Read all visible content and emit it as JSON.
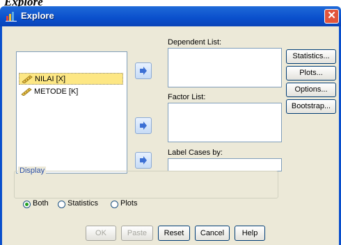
{
  "caption": "Explore",
  "window": {
    "title": "Explore",
    "close_symbol": "✕"
  },
  "variables": [
    {
      "label": "NILAI [X]",
      "icon": "scale-ruler-icon",
      "selected": true
    },
    {
      "label": "METODE [K]",
      "icon": "scale-ruler-icon",
      "selected": false
    }
  ],
  "labels": {
    "dependent_list": "Dependent List:",
    "factor_list": "Factor List:",
    "label_cases_by": "Label Cases by:"
  },
  "side_buttons": {
    "statistics": "Statistics...",
    "plots": "Plots...",
    "options": "Options...",
    "bootstrap": "Bootstrap..."
  },
  "display": {
    "legend": "Display",
    "options": [
      {
        "label": "Both",
        "selected": true
      },
      {
        "label": "Statistics",
        "selected": false
      },
      {
        "label": "Plots",
        "selected": false
      }
    ]
  },
  "buttons": {
    "ok": "OK",
    "paste": "Paste",
    "reset": "Reset",
    "cancel": "Cancel",
    "help": "Help"
  },
  "colors": {
    "titlebar": "#0a4fcc",
    "dialog_bg": "#ece9d8",
    "selection": "#fde784",
    "arrow": "#3b6fd4"
  }
}
